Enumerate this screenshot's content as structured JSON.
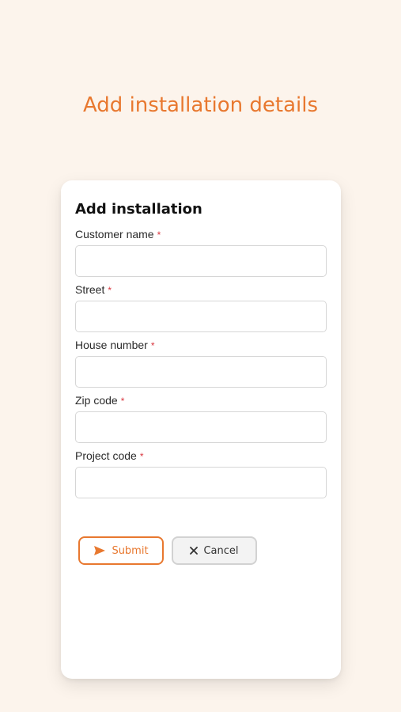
{
  "page": {
    "heading": "Add installation details"
  },
  "form": {
    "title": "Add installation",
    "required_marker": "*",
    "fields": [
      {
        "label": "Customer name",
        "value": "",
        "placeholder": ""
      },
      {
        "label": "Street",
        "value": "",
        "placeholder": ""
      },
      {
        "label": "House number",
        "value": "",
        "placeholder": ""
      },
      {
        "label": "Zip code",
        "value": "",
        "placeholder": ""
      },
      {
        "label": "Project code",
        "value": "",
        "placeholder": ""
      }
    ],
    "submit_label": "Submit",
    "submit_icon": "send-icon",
    "cancel_label": "Cancel",
    "cancel_icon": "close-icon"
  },
  "colors": {
    "accent": "#e8782f",
    "background": "#fcf4ec",
    "required": "#d9363e"
  }
}
